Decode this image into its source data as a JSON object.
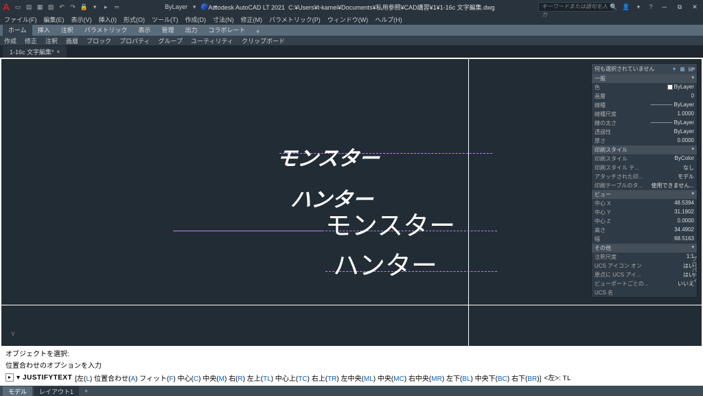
{
  "title": {
    "app": "Autodesk AutoCAD LT 2021",
    "file": "C:¥Users¥t-kamei¥Documents¥私用参照¥CAD講習¥1¥1-16c 文字編集.dwg"
  },
  "search_placeholder": "キーワードまたは語句を入力",
  "layer_current": "ByLayer",
  "menus": [
    "ファイル(F)",
    "編集(E)",
    "表示(V)",
    "挿入(I)",
    "形式(O)",
    "ツール(T)",
    "作成(D)",
    "寸法(N)",
    "修正(M)",
    "パラメトリック(P)",
    "ウィンドウ(W)",
    "ヘルプ(H)"
  ],
  "ribbon_tabs": [
    "ホーム",
    "挿入",
    "注釈",
    "パラメトリック",
    "表示",
    "管理",
    "出力",
    "コラボレート"
  ],
  "ribbon_panels": [
    "作成",
    "修正",
    "注釈",
    "画層",
    "ブロック",
    "プロパティ",
    "グループ",
    "ユーティリティ",
    "クリップボード"
  ],
  "doc_tab": "1-16c 文字編集*",
  "canvas_text": {
    "line1": "モンスター",
    "line2": "ハンター",
    "line3": "モンスター",
    "line4": "ハンター"
  },
  "axis_label": "Y",
  "properties": {
    "title": "何も選択されていません",
    "sections": {
      "general": {
        "label": "一般",
        "rows": [
          {
            "k": "色",
            "v": "ByLayer",
            "swatch": true
          },
          {
            "k": "画層",
            "v": "0"
          },
          {
            "k": "線種",
            "v": "———— ByLayer"
          },
          {
            "k": "線種尺度",
            "v": "1.0000"
          },
          {
            "k": "線の太さ",
            "v": "———— ByLayer"
          },
          {
            "k": "透過性",
            "v": "ByLayer"
          },
          {
            "k": "厚さ",
            "v": "0.0000"
          }
        ]
      },
      "plot": {
        "label": "印刷スタイル",
        "rows": [
          {
            "k": "印刷スタイル",
            "v": "ByColor"
          },
          {
            "k": "印刷スタイル テ...",
            "v": "なし"
          },
          {
            "k": "アタッチされた印...",
            "v": "モデル"
          },
          {
            "k": "印刷テーブルのタ...",
            "v": "使用できません..."
          }
        ]
      },
      "view": {
        "label": "ビュー",
        "rows": [
          {
            "k": "中心 X",
            "v": "48.5394"
          },
          {
            "k": "中心 Y",
            "v": "31.1902"
          },
          {
            "k": "中心 Z",
            "v": "0.0000"
          },
          {
            "k": "高さ",
            "v": "34.4902"
          },
          {
            "k": "幅",
            "v": "68.5163"
          }
        ]
      },
      "misc": {
        "label": "その他",
        "rows": [
          {
            "k": "注釈尺度",
            "v": "1:1"
          },
          {
            "k": "UCS アイコン オン",
            "v": "はい"
          },
          {
            "k": "原点に UCS アイ...",
            "v": "はい"
          },
          {
            "k": "ビューポートごとの...",
            "v": "いいえ"
          },
          {
            "k": "UCS 名",
            "v": ""
          }
        ]
      }
    },
    "side_label": "プロパティ"
  },
  "command": {
    "history": [
      "オブジェクトを選択:",
      "位置合わせのオプションを入力"
    ],
    "name": "JUSTIFYTEXT",
    "options": [
      {
        "t": "左",
        "k": "L"
      },
      {
        "t": "位置合わせ",
        "k": "A"
      },
      {
        "t": "フィット",
        "k": "F"
      },
      {
        "t": "中心",
        "k": "C"
      },
      {
        "t": "中央",
        "k": "M"
      },
      {
        "t": "右",
        "k": "R"
      },
      {
        "t": "左上",
        "k": "TL"
      },
      {
        "t": "中心上",
        "k": "TC"
      },
      {
        "t": "右上",
        "k": "TR"
      },
      {
        "t": "左中央",
        "k": "ML"
      },
      {
        "t": "中央",
        "k": "MC"
      },
      {
        "t": "右中央",
        "k": "MR"
      },
      {
        "t": "左下",
        "k": "BL"
      },
      {
        "t": "中央下",
        "k": "BC"
      },
      {
        "t": "右下",
        "k": "BR"
      }
    ],
    "default": "<左>:",
    "input": "TL"
  },
  "status_tabs": {
    "model": "モデル",
    "layout": "レイアウト1"
  }
}
